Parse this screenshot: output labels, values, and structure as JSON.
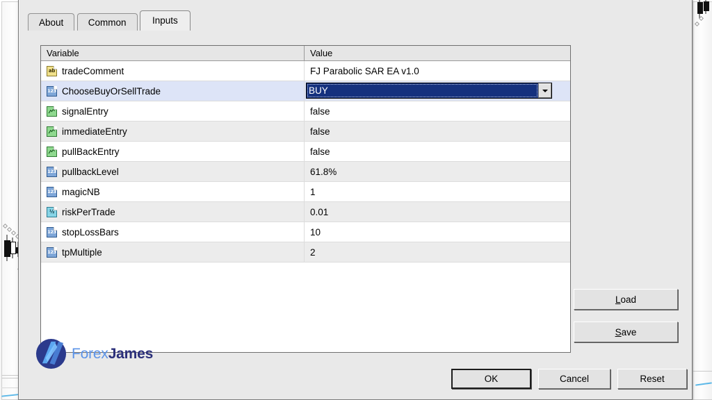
{
  "dialog": {
    "tabs": [
      {
        "label": "About",
        "active": false
      },
      {
        "label": "Common",
        "active": false
      },
      {
        "label": "Inputs",
        "active": true
      }
    ],
    "table": {
      "headers": {
        "variable": "Variable",
        "value": "Value"
      },
      "rows": [
        {
          "icon": "string-type-icon",
          "icon_label": "ab",
          "variable": "tradeComment",
          "value": "FJ Parabolic SAR EA v1.0",
          "editor": "text"
        },
        {
          "icon": "integer-type-icon",
          "icon_label": "123",
          "variable": "ChooseBuyOrSellTrade",
          "value": "BUY",
          "editor": "combobox"
        },
        {
          "icon": "boolean-type-icon",
          "icon_label": "",
          "variable": "signalEntry",
          "value": "false",
          "editor": "text"
        },
        {
          "icon": "boolean-type-icon",
          "icon_label": "",
          "variable": "immediateEntry",
          "value": "false",
          "editor": "text"
        },
        {
          "icon": "boolean-type-icon",
          "icon_label": "",
          "variable": "pullBackEntry",
          "value": "false",
          "editor": "text"
        },
        {
          "icon": "integer-type-icon",
          "icon_label": "123",
          "variable": "pullbackLevel",
          "value": "61.8%",
          "editor": "text"
        },
        {
          "icon": "integer-type-icon",
          "icon_label": "123",
          "variable": "magicNB",
          "value": "1",
          "editor": "text"
        },
        {
          "icon": "double-type-icon",
          "icon_label": "½",
          "variable": "riskPerTrade",
          "value": "0.01",
          "editor": "text"
        },
        {
          "icon": "integer-type-icon",
          "icon_label": "123",
          "variable": "stopLossBars",
          "value": "10",
          "editor": "text"
        },
        {
          "icon": "integer-type-icon",
          "icon_label": "123",
          "variable": "tpMultiple",
          "value": "2",
          "editor": "text"
        }
      ]
    },
    "side_buttons": {
      "load": {
        "mnemonic": "L",
        "rest": "oad"
      },
      "save": {
        "mnemonic": "S",
        "rest": "ave"
      }
    },
    "footer_buttons": {
      "ok": "OK",
      "cancel": "Cancel",
      "reset": "Reset"
    }
  },
  "branding": {
    "logo_first": "Forex",
    "logo_second": "James",
    "color_first": "#5b93e8",
    "color_second": "#2b2f7a"
  },
  "selection": {
    "selected_row_index": 1,
    "selected_value": "BUY",
    "highlight_color": "#15317e",
    "row_highlight_color": "#dde4f7"
  }
}
